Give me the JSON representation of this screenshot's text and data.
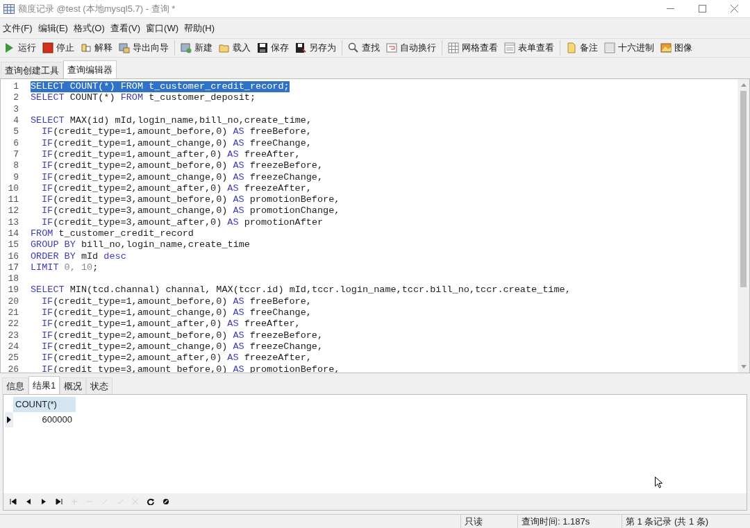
{
  "window": {
    "title": "额度记录 @test (本地mysql5.7) - 查询 *"
  },
  "menu": [
    "文件(F)",
    "编辑(E)",
    "格式(O)",
    "查看(V)",
    "窗口(W)",
    "帮助(H)"
  ],
  "toolbar": [
    [
      {
        "kind": "run",
        "label": "运行"
      },
      {
        "kind": "stop",
        "label": "停止"
      },
      {
        "kind": "explain",
        "label": "解释"
      },
      {
        "kind": "export",
        "label": "导出向导"
      }
    ],
    [
      {
        "kind": "new",
        "label": "新建"
      },
      {
        "kind": "load",
        "label": "载入"
      },
      {
        "kind": "save",
        "label": "保存"
      },
      {
        "kind": "saveas",
        "label": "另存为"
      }
    ],
    [
      {
        "kind": "find",
        "label": "查找"
      },
      {
        "kind": "wrap",
        "label": "自动换行"
      }
    ],
    [
      {
        "kind": "grid",
        "label": "网格查看"
      },
      {
        "kind": "form",
        "label": "表单查看"
      }
    ],
    [
      {
        "kind": "note",
        "label": "备注"
      },
      {
        "kind": "hex",
        "label": "十六进制"
      },
      {
        "kind": "image",
        "label": "图像"
      }
    ]
  ],
  "editor_tabs": [
    {
      "label": "查询创建工具",
      "selected": false
    },
    {
      "label": "查询编辑器",
      "selected": true
    }
  ],
  "editor": {
    "lines": [
      {
        "number": "1",
        "selected": true,
        "indented": false,
        "tokens": [
          {
            "kind": "keyword",
            "text": "SELECT"
          },
          {
            "kind": "plain",
            "text": " COUNT(*) "
          },
          {
            "kind": "keyword",
            "text": "FROM"
          },
          {
            "kind": "plain",
            "text": " t_customer_credit_record;"
          }
        ]
      },
      {
        "number": "2",
        "selected": false,
        "indented": false,
        "tokens": [
          {
            "kind": "keyword",
            "text": "SELECT"
          },
          {
            "kind": "plain",
            "text": " COUNT(*) "
          },
          {
            "kind": "keyword",
            "text": "FROM"
          },
          {
            "kind": "plain",
            "text": " t_customer_deposit;"
          }
        ]
      },
      {
        "number": "3",
        "selected": false
      },
      {
        "number": "4",
        "selected": false,
        "indented": false,
        "tokens": [
          {
            "kind": "keyword",
            "text": "SELECT"
          },
          {
            "kind": "plain",
            "text": " MAX(id) mId,login_name,bill_no,create_time,"
          }
        ]
      },
      {
        "number": "5",
        "selected": false,
        "indented": true,
        "tokens": [
          {
            "kind": "keyword",
            "text": "IF"
          },
          {
            "kind": "plain",
            "text": "(credit_type=1,amount_before,0) "
          },
          {
            "kind": "keyword",
            "text": "AS"
          },
          {
            "kind": "plain",
            "text": " freeBefore,"
          }
        ]
      },
      {
        "number": "6",
        "selected": false,
        "indented": true,
        "tokens": [
          {
            "kind": "keyword",
            "text": "IF"
          },
          {
            "kind": "plain",
            "text": "(credit_type=1,amount_change,0) "
          },
          {
            "kind": "keyword",
            "text": "AS"
          },
          {
            "kind": "plain",
            "text": " freeChange,"
          }
        ]
      },
      {
        "number": "7",
        "selected": false,
        "indented": true,
        "tokens": [
          {
            "kind": "keyword",
            "text": "IF"
          },
          {
            "kind": "plain",
            "text": "(credit_type=1,amount_after,0) "
          },
          {
            "kind": "keyword",
            "text": "AS"
          },
          {
            "kind": "plain",
            "text": " freeAfter,"
          }
        ]
      },
      {
        "number": "8",
        "selected": false,
        "indented": true,
        "tokens": [
          {
            "kind": "keyword",
            "text": "IF"
          },
          {
            "kind": "plain",
            "text": "(credit_type=2,amount_before,0) "
          },
          {
            "kind": "keyword",
            "text": "AS"
          },
          {
            "kind": "plain",
            "text": " freezeBefore,"
          }
        ]
      },
      {
        "number": "9",
        "selected": false,
        "indented": true,
        "tokens": [
          {
            "kind": "keyword",
            "text": "IF"
          },
          {
            "kind": "plain",
            "text": "(credit_type=2,amount_change,0) "
          },
          {
            "kind": "keyword",
            "text": "AS"
          },
          {
            "kind": "plain",
            "text": " freezeChange,"
          }
        ]
      },
      {
        "number": "10",
        "selected": false,
        "indented": true,
        "tokens": [
          {
            "kind": "keyword",
            "text": "IF"
          },
          {
            "kind": "plain",
            "text": "(credit_type=2,amount_after,0) "
          },
          {
            "kind": "keyword",
            "text": "AS"
          },
          {
            "kind": "plain",
            "text": " freezeAfter,"
          }
        ]
      },
      {
        "number": "11",
        "selected": false,
        "indented": true,
        "tokens": [
          {
            "kind": "keyword",
            "text": "IF"
          },
          {
            "kind": "plain",
            "text": "(credit_type=3,amount_before,0) "
          },
          {
            "kind": "keyword",
            "text": "AS"
          },
          {
            "kind": "plain",
            "text": " promotionBefore,"
          }
        ]
      },
      {
        "number": "12",
        "selected": false,
        "indented": true,
        "tokens": [
          {
            "kind": "keyword",
            "text": "IF"
          },
          {
            "kind": "plain",
            "text": "(credit_type=3,amount_change,0) "
          },
          {
            "kind": "keyword",
            "text": "AS"
          },
          {
            "kind": "plain",
            "text": " promotionChange,"
          }
        ]
      },
      {
        "number": "13",
        "selected": false,
        "indented": true,
        "tokens": [
          {
            "kind": "keyword",
            "text": "IF"
          },
          {
            "kind": "plain",
            "text": "(credit_type=3,amount_after,0) "
          },
          {
            "kind": "keyword",
            "text": "AS"
          },
          {
            "kind": "plain",
            "text": " promotionAfter"
          }
        ]
      },
      {
        "number": "14",
        "selected": false,
        "indented": false,
        "tokens": [
          {
            "kind": "keyword",
            "text": "FROM"
          },
          {
            "kind": "plain",
            "text": " t_customer_credit_record"
          }
        ]
      },
      {
        "number": "15",
        "selected": false,
        "indented": false,
        "tokens": [
          {
            "kind": "keyword",
            "text": "GROUP BY"
          },
          {
            "kind": "plain",
            "text": " bill_no,login_name,create_time"
          }
        ]
      },
      {
        "number": "16",
        "selected": false,
        "indented": false,
        "tokens": [
          {
            "kind": "keyword",
            "text": "ORDER BY"
          },
          {
            "kind": "plain",
            "text": " mId "
          },
          {
            "kind": "keyword",
            "text": "desc"
          }
        ]
      },
      {
        "number": "17",
        "selected": false,
        "indented": false,
        "tokens": [
          {
            "kind": "keyword",
            "text": "LIMIT"
          },
          {
            "kind": "number",
            "text": " 0, 10"
          },
          {
            "kind": "plain",
            "text": ";"
          }
        ]
      },
      {
        "number": "18",
        "selected": false
      },
      {
        "number": "19",
        "selected": false,
        "indented": false,
        "tokens": [
          {
            "kind": "keyword",
            "text": "SELECT"
          },
          {
            "kind": "plain",
            "text": " MIN(tcd.channal) channal, MAX(tccr.id) mId,tccr.login_name,tccr.bill_no,tccr.create_time,"
          }
        ]
      },
      {
        "number": "20",
        "selected": false,
        "indented": true,
        "tokens": [
          {
            "kind": "keyword",
            "text": "IF"
          },
          {
            "kind": "plain",
            "text": "(credit_type=1,amount_before,0) "
          },
          {
            "kind": "keyword",
            "text": "AS"
          },
          {
            "kind": "plain",
            "text": " freeBefore,"
          }
        ]
      },
      {
        "number": "21",
        "selected": false,
        "indented": true,
        "tokens": [
          {
            "kind": "keyword",
            "text": "IF"
          },
          {
            "kind": "plain",
            "text": "(credit_type=1,amount_change,0) "
          },
          {
            "kind": "keyword",
            "text": "AS"
          },
          {
            "kind": "plain",
            "text": " freeChange,"
          }
        ]
      },
      {
        "number": "22",
        "selected": false,
        "indented": true,
        "tokens": [
          {
            "kind": "keyword",
            "text": "IF"
          },
          {
            "kind": "plain",
            "text": "(credit_type=1,amount_after,0) "
          },
          {
            "kind": "keyword",
            "text": "AS"
          },
          {
            "kind": "plain",
            "text": " freeAfter,"
          }
        ]
      },
      {
        "number": "23",
        "selected": false,
        "indented": true,
        "tokens": [
          {
            "kind": "keyword",
            "text": "IF"
          },
          {
            "kind": "plain",
            "text": "(credit_type=2,amount_before,0) "
          },
          {
            "kind": "keyword",
            "text": "AS"
          },
          {
            "kind": "plain",
            "text": " freezeBefore,"
          }
        ]
      },
      {
        "number": "24",
        "selected": false,
        "indented": true,
        "tokens": [
          {
            "kind": "keyword",
            "text": "IF"
          },
          {
            "kind": "plain",
            "text": "(credit_type=2,amount_change,0) "
          },
          {
            "kind": "keyword",
            "text": "AS"
          },
          {
            "kind": "plain",
            "text": " freezeChange,"
          }
        ]
      },
      {
        "number": "25",
        "selected": false,
        "indented": true,
        "tokens": [
          {
            "kind": "keyword",
            "text": "IF"
          },
          {
            "kind": "plain",
            "text": "(credit_type=2,amount_after,0) "
          },
          {
            "kind": "keyword",
            "text": "AS"
          },
          {
            "kind": "plain",
            "text": " freezeAfter,"
          }
        ]
      },
      {
        "number": "26",
        "selected": false,
        "indented": true,
        "tokens": [
          {
            "kind": "keyword",
            "text": "IF"
          },
          {
            "kind": "plain",
            "text": "(credit_type=3,amount_before,0) "
          },
          {
            "kind": "keyword",
            "text": "AS"
          },
          {
            "kind": "plain",
            "text": " promotionBefore,"
          }
        ]
      }
    ]
  },
  "result_tabs": [
    {
      "label": "信息",
      "selected": false
    },
    {
      "label": "结果1",
      "selected": true
    },
    {
      "label": "概况",
      "selected": false
    },
    {
      "label": "状态",
      "selected": false
    }
  ],
  "result_table": {
    "columns": [
      "COUNT(*)"
    ],
    "rows": [
      {
        "selected": true,
        "cells": [
          "600000"
        ]
      }
    ]
  },
  "navigator": [
    {
      "kind": "first",
      "disabled": false
    },
    {
      "kind": "prev",
      "disabled": false
    },
    {
      "kind": "next",
      "disabled": false
    },
    {
      "kind": "last",
      "disabled": false
    },
    {
      "kind": "add",
      "disabled": true
    },
    {
      "kind": "delete",
      "disabled": true
    },
    {
      "kind": "edit",
      "disabled": true
    },
    {
      "kind": "apply",
      "disabled": true
    },
    {
      "kind": "cancel",
      "disabled": true
    },
    {
      "kind": "refresh",
      "disabled": false
    },
    {
      "kind": "stop",
      "disabled": false
    }
  ],
  "status_bar": [
    "只读",
    "查询时间: 1.187s",
    "第 1 条记录 (共 1 条)"
  ]
}
